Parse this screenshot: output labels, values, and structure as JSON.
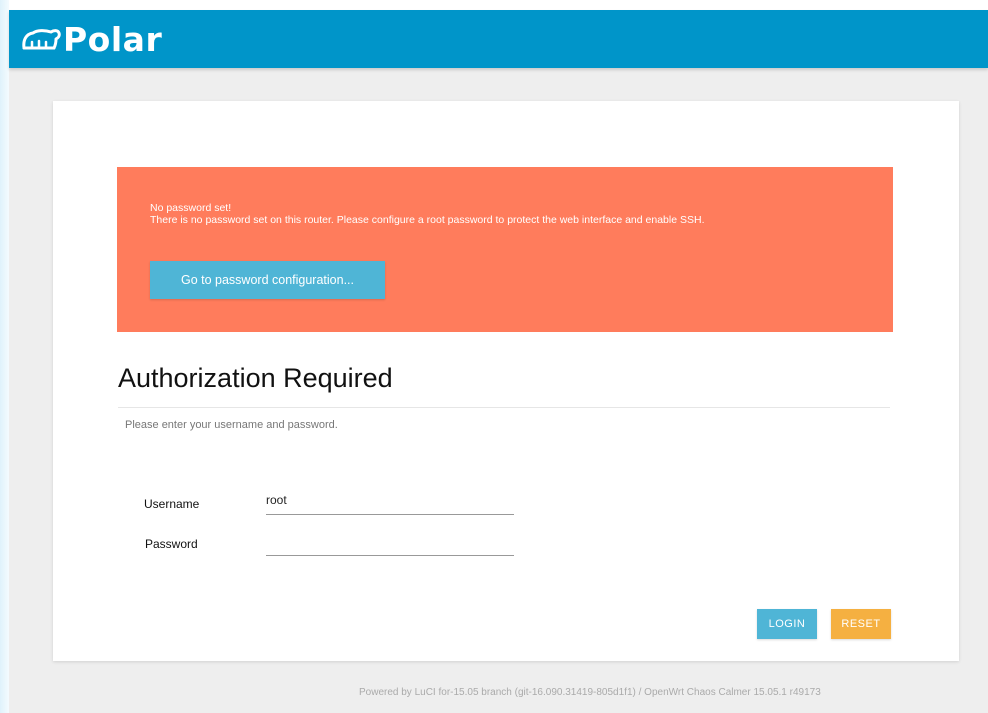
{
  "header": {
    "logo_text": "Polar",
    "logo_icon": "polar-bear-icon",
    "color": "#0095c9"
  },
  "alert": {
    "title": "No password set!",
    "message": "There is no password set on this router. Please configure a root password to protect the web interface and enable SSH.",
    "button_label": "Go to password configuration...",
    "color": "#ff7c5c"
  },
  "auth": {
    "title": "Authorization Required",
    "subtitle": "Please enter your username and password.",
    "username_label": "Username",
    "username_value": "root",
    "password_label": "Password",
    "password_value": "",
    "login_label": "LOGIN",
    "reset_label": "RESET"
  },
  "footer": {
    "text": "Powered by LuCI for-15.05 branch (git-16.090.31419-805d1f1) / OpenWrt Chaos Calmer 15.05.1 r49173"
  },
  "colors": {
    "accent": "#4fb5d6",
    "reset": "#f5b041"
  }
}
